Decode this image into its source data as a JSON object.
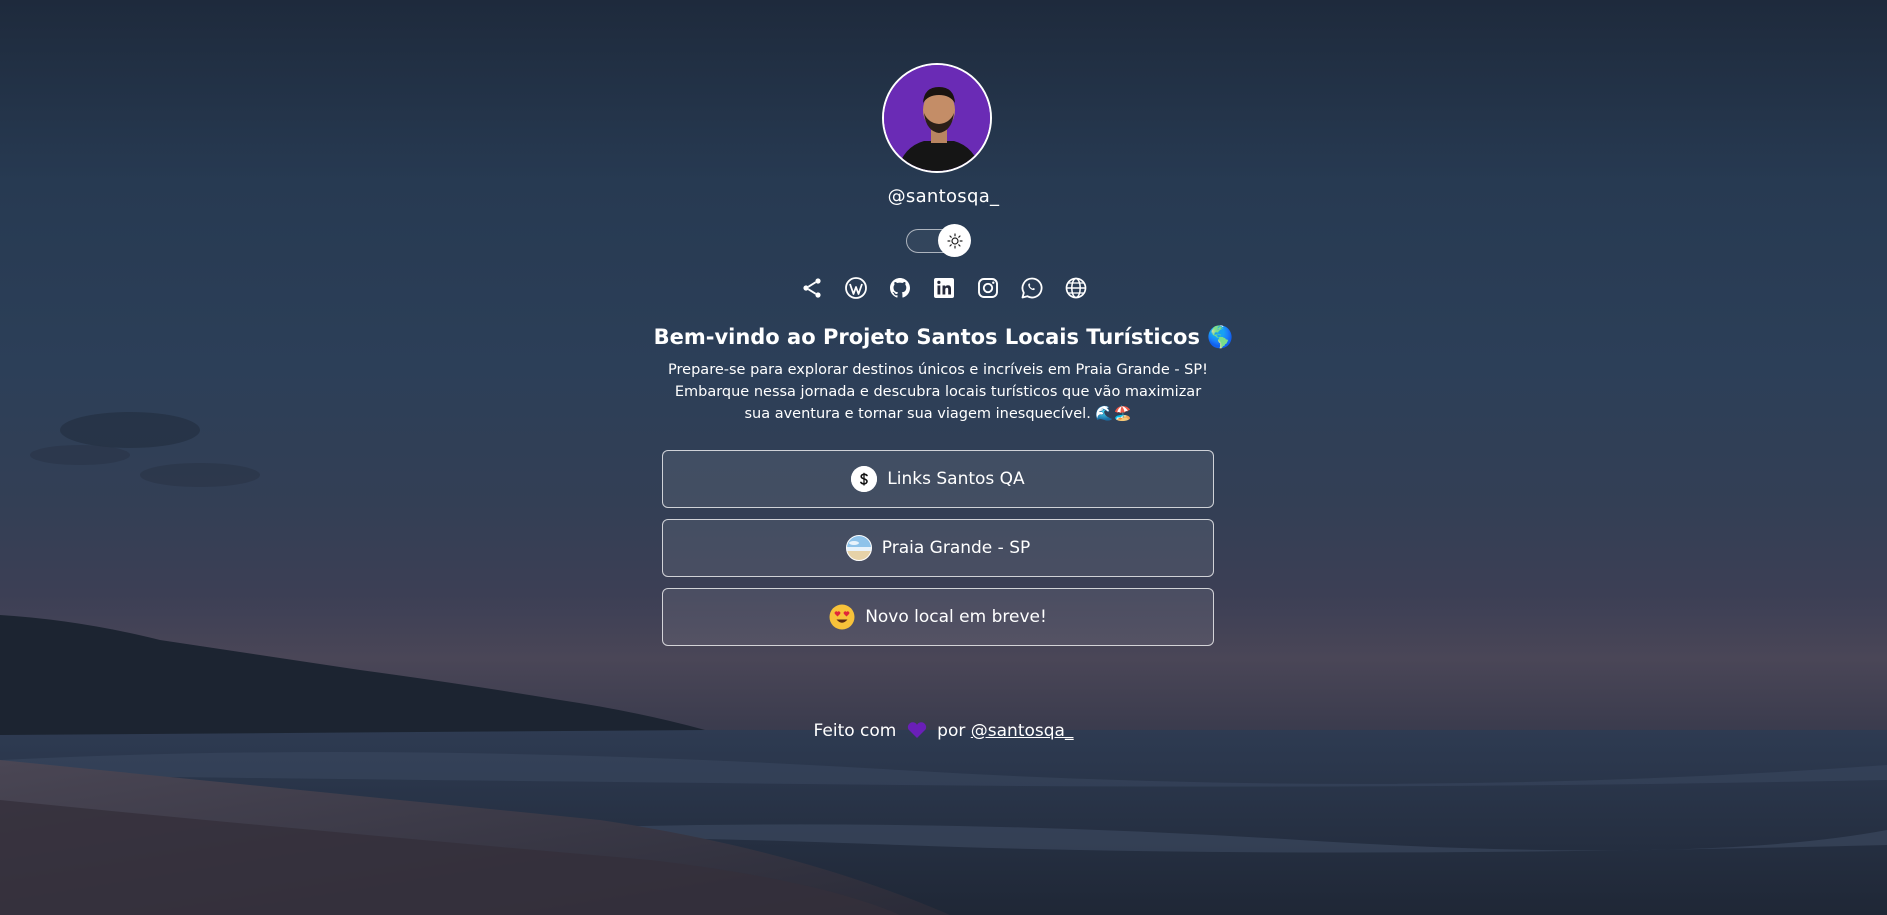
{
  "profile": {
    "username": "@santosqa_"
  },
  "theme_toggle": {
    "icon": "sun-icon"
  },
  "socials": [
    {
      "icon": "share-icon"
    },
    {
      "icon": "wordpress-icon"
    },
    {
      "icon": "github-icon"
    },
    {
      "icon": "linkedin-icon"
    },
    {
      "icon": "instagram-icon"
    },
    {
      "icon": "whatsapp-icon"
    },
    {
      "icon": "globe-icon"
    }
  ],
  "intro": {
    "title": "Bem-vindo ao Projeto Santos Locais Turísticos 🌎",
    "description": "Prepare-se para explorar destinos únicos e incríveis em Praia Grande - SP! Embarque nessa jornada e descubra locais turísticos que vão maximizar sua aventura e tornar sua viagem inesquecível. 🌊🏖️"
  },
  "links": [
    {
      "label": "Links Santos QA",
      "icon": "santos-logo-icon"
    },
    {
      "label": "Praia Grande - SP",
      "icon": "beach-photo-icon"
    },
    {
      "label": "Novo local em breve!",
      "icon": "heart-eyes-emoji-icon"
    }
  ],
  "footer": {
    "prefix": "Feito com",
    "middle": "por",
    "author": "@santosqa_",
    "heart_color": "#6a1fb8"
  },
  "colors": {
    "avatar_bg": "#6a2bb5",
    "text": "#ffffff"
  }
}
